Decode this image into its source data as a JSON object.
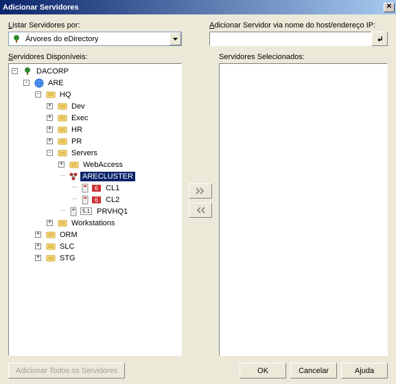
{
  "title": "Adicionar Servidores",
  "labels": {
    "list_by_pre": "L",
    "list_by": "istar Servidores por:",
    "add_host_pre": "A",
    "add_host": "dicionar Servidor via nome do host/endereço IP:",
    "available_pre": "S",
    "available": "ervidores Disponíveis:",
    "selected": "Servidores Selecionados:"
  },
  "combo": {
    "text": "Árvores do eDirectory"
  },
  "input": {
    "value": ""
  },
  "buttons": {
    "add_all": "Adicionar Todos os Servidores",
    "ok": "OK",
    "cancel": "Cancelar",
    "help": "Ajuda",
    "close": "X",
    "move_right": "▶▶",
    "move_left": "◀◀",
    "go": "↲"
  },
  "tree": {
    "root": "DACORP",
    "n1": "ARE",
    "n2": "HQ",
    "hq_children": [
      "Dev",
      "Exec",
      "HR",
      "PR"
    ],
    "servers": "Servers",
    "webaccess": "WebAccess",
    "arecluster": "ARECLUSTER",
    "cluster_children": [
      "CL1",
      "CL2"
    ],
    "prv": "PRVHQ1",
    "workstations": "Workstations",
    "are_tail": [
      "ORM",
      "SLC",
      "STG"
    ]
  }
}
